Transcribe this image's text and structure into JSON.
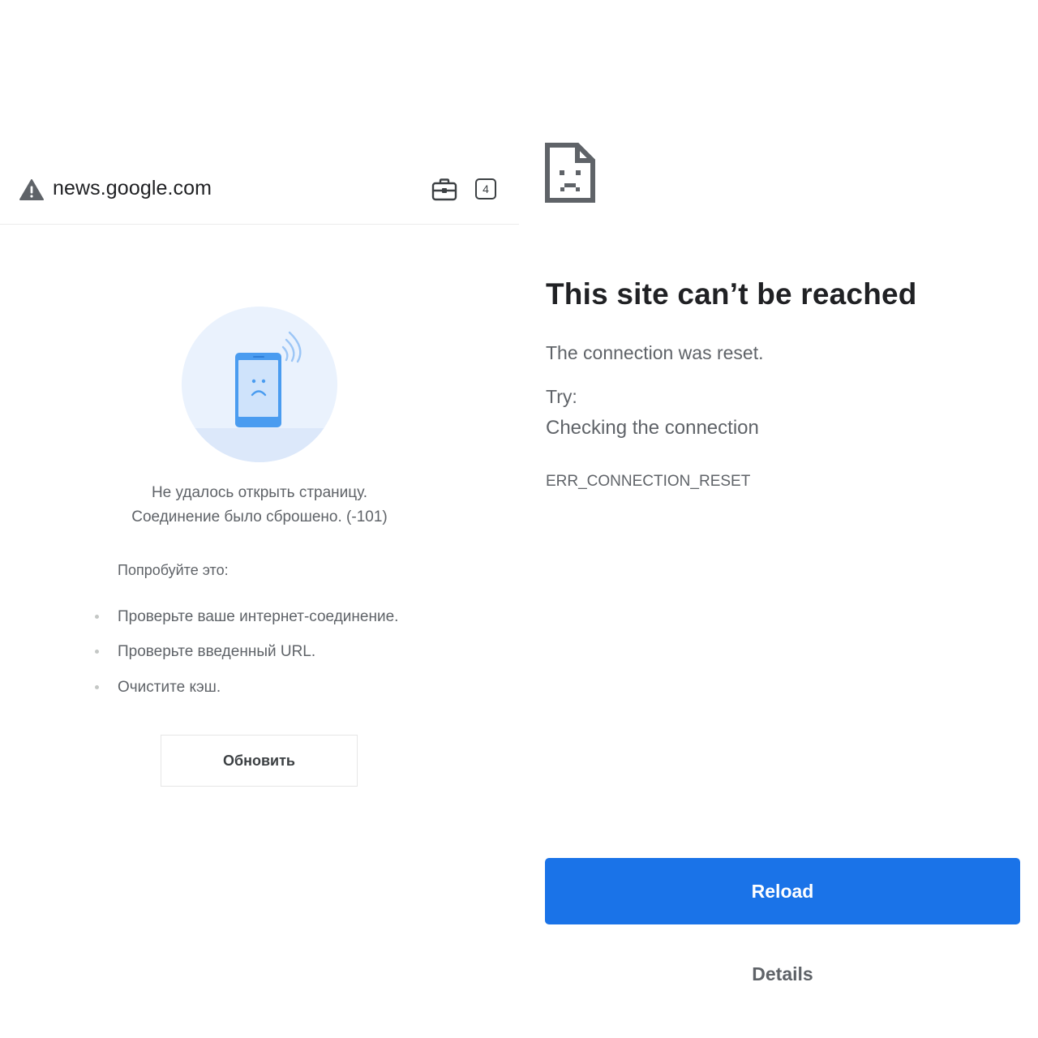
{
  "left_panel": {
    "address_bar": {
      "url": "news.google.com",
      "tab_count": "4",
      "icons": [
        "warning-icon",
        "briefcase-icon"
      ]
    },
    "message_line1": "Не удалось открыть страницу.",
    "message_line2": "Соединение было сброшено. (-101)",
    "try_label": "Попробуйте это:",
    "tips": [
      "Проверьте ваше интернет-соединение.",
      "Проверьте введенный URL.",
      "Очистите кэш."
    ],
    "refresh_label": "Обновить",
    "illustration_icon": "sad-phone-icon"
  },
  "right_panel": {
    "icon": "sad-document-icon",
    "title": "This site can’t be reached",
    "description": "The connection was reset.",
    "try_label": "Try:",
    "suggestion": "Checking the connection",
    "error_code": "ERR_CONNECTION_RESET",
    "reload_label": "Reload",
    "details_label": "Details"
  },
  "colors": {
    "primary_blue": "#1a73e8",
    "text_dark": "#202124",
    "text_grey": "#5f6368",
    "illustration_bg": "#e8f0fe",
    "phone_blue": "#4a9cf0"
  }
}
